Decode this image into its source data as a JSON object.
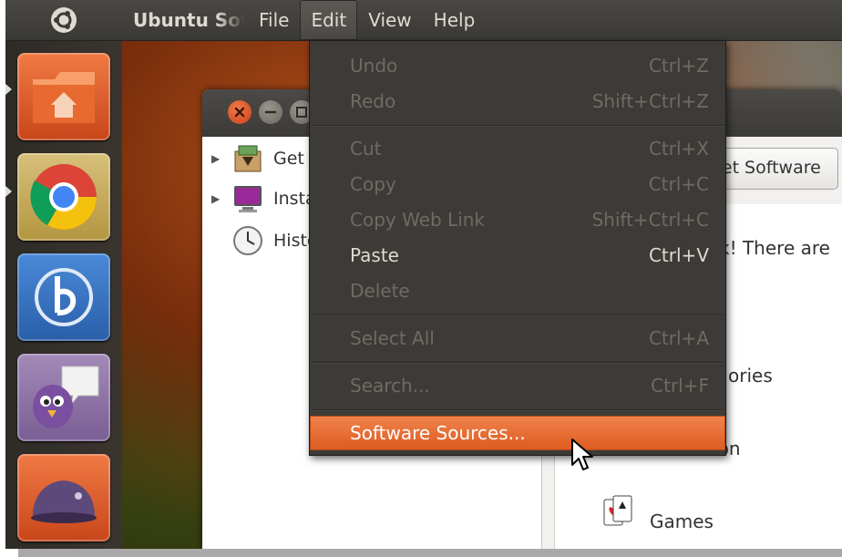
{
  "app": {
    "title": "Ubuntu Software Center"
  },
  "menubar": {
    "items": [
      "File",
      "Edit",
      "View",
      "Help"
    ],
    "active": "Edit"
  },
  "edit_menu": {
    "items": [
      {
        "label": "Undo",
        "accel": "Ctrl+Z",
        "enabled": false
      },
      {
        "label": "Redo",
        "accel": "Shift+Ctrl+Z",
        "enabled": false
      },
      {
        "label": "Cut",
        "accel": "Ctrl+X",
        "enabled": false
      },
      {
        "label": "Copy",
        "accel": "Ctrl+C",
        "enabled": false
      },
      {
        "label": "Copy Web Link",
        "accel": "Shift+Ctrl+C",
        "enabled": false
      },
      {
        "label": "Paste",
        "accel": "Ctrl+V",
        "enabled": true
      },
      {
        "label": "Delete",
        "accel": "",
        "enabled": false
      },
      {
        "label": "Select All",
        "accel": "Ctrl+A",
        "enabled": false
      },
      {
        "label": "Search...",
        "accel": "Ctrl+F",
        "enabled": false
      },
      {
        "label": "Software Sources...",
        "accel": "",
        "enabled": true,
        "highlighted": true
      }
    ]
  },
  "sidebar": {
    "items": [
      {
        "label": "Get Software",
        "icon": "get-software-icon"
      },
      {
        "label": "Installed Software",
        "icon": "installed-software-icon"
      },
      {
        "label": "History",
        "icon": "history-icon"
      }
    ]
  },
  "toolbar": {
    "button_label": "Get Software"
  },
  "content": {
    "notice": "k! There are",
    "categories_partial": "ories",
    "education_partial": "Education",
    "games_label": "Games"
  },
  "launcher": {
    "items": [
      "home-folder-icon",
      "chrome-icon",
      "bluefish-icon",
      "pidgin-icon",
      "software-center-icon"
    ]
  },
  "colors": {
    "accent": "#dd5a1f",
    "menu_bg": "#3c3b37",
    "panel_bg": "#3c3b37"
  }
}
